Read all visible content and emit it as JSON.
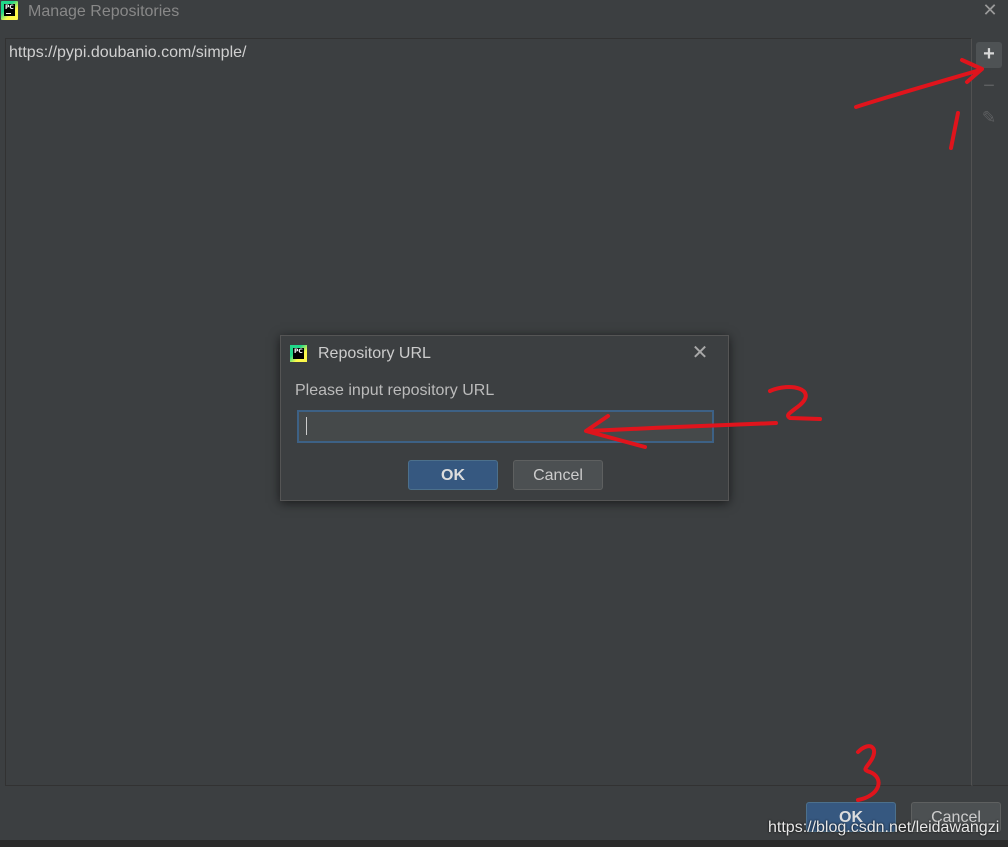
{
  "window": {
    "title": "Manage Repositories",
    "app_logo_text": "PC"
  },
  "repositories": [
    "https://pypi.doubanio.com/simple/"
  ],
  "toolbar": {
    "add_label": "+",
    "remove_label": "−",
    "edit_label": "✎"
  },
  "buttons": {
    "ok_label": "OK",
    "cancel_label": "Cancel"
  },
  "dialog": {
    "title": "Repository URL",
    "prompt": "Please input repository URL",
    "input_value": "",
    "ok_label": "OK",
    "cancel_label": "Cancel"
  },
  "annotations": {
    "step1": "1",
    "step2": "2",
    "step3": "3",
    "color": "#e0141c"
  },
  "watermark": "https://blog.csdn.net/leidawangzi",
  "colors": {
    "background": "#3c3f41",
    "primary_button": "#365880",
    "input_focus": "#3d6185"
  }
}
